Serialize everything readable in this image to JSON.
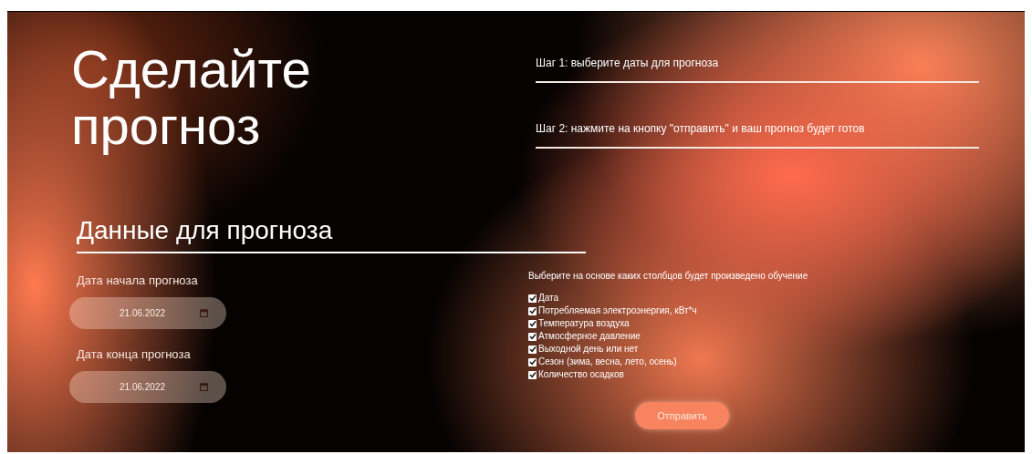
{
  "hero": {
    "title_lines": [
      "Сделайте",
      "прогноз"
    ]
  },
  "steps": [
    {
      "text": "Шаг 1: выберите даты для прогноза"
    },
    {
      "text": "Шаг 2: нажмите на кнопку \"отправить\" и ваш прогноз будет готов"
    }
  ],
  "section": {
    "title": "Данные для прогноза"
  },
  "dates": [
    {
      "label": "Дата начала прогноза",
      "value": "21.06.2022"
    },
    {
      "label": "Дата конца прогноза",
      "value": "21.06.2022"
    }
  ],
  "columns": {
    "caption": "Выберите на основе каких столбцов будет произведено обучение",
    "options": [
      {
        "label": "Дата",
        "checked": true
      },
      {
        "label": "Потребляемая электроэнергия, кВт*ч",
        "checked": true
      },
      {
        "label": "Температура воздуха",
        "checked": true
      },
      {
        "label": "Атмосферное давление",
        "checked": true
      },
      {
        "label": "Выходной день или нет",
        "checked": true
      },
      {
        "label": "Сезон (зима, весна, лето, осень)",
        "checked": true
      },
      {
        "label": "Количество осадков",
        "checked": true
      }
    ]
  },
  "submit": {
    "label": "Отправить"
  }
}
